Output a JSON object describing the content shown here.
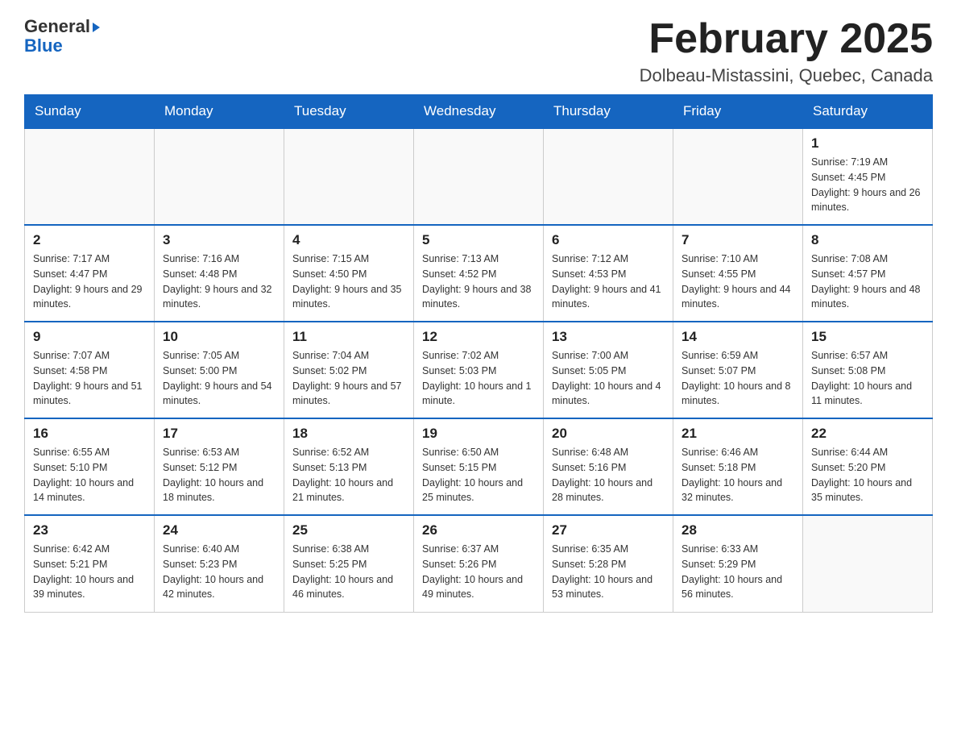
{
  "header": {
    "logo_general": "General",
    "logo_blue": "Blue",
    "month_title": "February 2025",
    "location": "Dolbeau-Mistassini, Quebec, Canada"
  },
  "days_of_week": [
    "Sunday",
    "Monday",
    "Tuesday",
    "Wednesday",
    "Thursday",
    "Friday",
    "Saturday"
  ],
  "weeks": [
    [
      {
        "day": "",
        "sunrise": "",
        "sunset": "",
        "daylight": ""
      },
      {
        "day": "",
        "sunrise": "",
        "sunset": "",
        "daylight": ""
      },
      {
        "day": "",
        "sunrise": "",
        "sunset": "",
        "daylight": ""
      },
      {
        "day": "",
        "sunrise": "",
        "sunset": "",
        "daylight": ""
      },
      {
        "day": "",
        "sunrise": "",
        "sunset": "",
        "daylight": ""
      },
      {
        "day": "",
        "sunrise": "",
        "sunset": "",
        "daylight": ""
      },
      {
        "day": "1",
        "sunrise": "Sunrise: 7:19 AM",
        "sunset": "Sunset: 4:45 PM",
        "daylight": "Daylight: 9 hours and 26 minutes."
      }
    ],
    [
      {
        "day": "2",
        "sunrise": "Sunrise: 7:17 AM",
        "sunset": "Sunset: 4:47 PM",
        "daylight": "Daylight: 9 hours and 29 minutes."
      },
      {
        "day": "3",
        "sunrise": "Sunrise: 7:16 AM",
        "sunset": "Sunset: 4:48 PM",
        "daylight": "Daylight: 9 hours and 32 minutes."
      },
      {
        "day": "4",
        "sunrise": "Sunrise: 7:15 AM",
        "sunset": "Sunset: 4:50 PM",
        "daylight": "Daylight: 9 hours and 35 minutes."
      },
      {
        "day": "5",
        "sunrise": "Sunrise: 7:13 AM",
        "sunset": "Sunset: 4:52 PM",
        "daylight": "Daylight: 9 hours and 38 minutes."
      },
      {
        "day": "6",
        "sunrise": "Sunrise: 7:12 AM",
        "sunset": "Sunset: 4:53 PM",
        "daylight": "Daylight: 9 hours and 41 minutes."
      },
      {
        "day": "7",
        "sunrise": "Sunrise: 7:10 AM",
        "sunset": "Sunset: 4:55 PM",
        "daylight": "Daylight: 9 hours and 44 minutes."
      },
      {
        "day": "8",
        "sunrise": "Sunrise: 7:08 AM",
        "sunset": "Sunset: 4:57 PM",
        "daylight": "Daylight: 9 hours and 48 minutes."
      }
    ],
    [
      {
        "day": "9",
        "sunrise": "Sunrise: 7:07 AM",
        "sunset": "Sunset: 4:58 PM",
        "daylight": "Daylight: 9 hours and 51 minutes."
      },
      {
        "day": "10",
        "sunrise": "Sunrise: 7:05 AM",
        "sunset": "Sunset: 5:00 PM",
        "daylight": "Daylight: 9 hours and 54 minutes."
      },
      {
        "day": "11",
        "sunrise": "Sunrise: 7:04 AM",
        "sunset": "Sunset: 5:02 PM",
        "daylight": "Daylight: 9 hours and 57 minutes."
      },
      {
        "day": "12",
        "sunrise": "Sunrise: 7:02 AM",
        "sunset": "Sunset: 5:03 PM",
        "daylight": "Daylight: 10 hours and 1 minute."
      },
      {
        "day": "13",
        "sunrise": "Sunrise: 7:00 AM",
        "sunset": "Sunset: 5:05 PM",
        "daylight": "Daylight: 10 hours and 4 minutes."
      },
      {
        "day": "14",
        "sunrise": "Sunrise: 6:59 AM",
        "sunset": "Sunset: 5:07 PM",
        "daylight": "Daylight: 10 hours and 8 minutes."
      },
      {
        "day": "15",
        "sunrise": "Sunrise: 6:57 AM",
        "sunset": "Sunset: 5:08 PM",
        "daylight": "Daylight: 10 hours and 11 minutes."
      }
    ],
    [
      {
        "day": "16",
        "sunrise": "Sunrise: 6:55 AM",
        "sunset": "Sunset: 5:10 PM",
        "daylight": "Daylight: 10 hours and 14 minutes."
      },
      {
        "day": "17",
        "sunrise": "Sunrise: 6:53 AM",
        "sunset": "Sunset: 5:12 PM",
        "daylight": "Daylight: 10 hours and 18 minutes."
      },
      {
        "day": "18",
        "sunrise": "Sunrise: 6:52 AM",
        "sunset": "Sunset: 5:13 PM",
        "daylight": "Daylight: 10 hours and 21 minutes."
      },
      {
        "day": "19",
        "sunrise": "Sunrise: 6:50 AM",
        "sunset": "Sunset: 5:15 PM",
        "daylight": "Daylight: 10 hours and 25 minutes."
      },
      {
        "day": "20",
        "sunrise": "Sunrise: 6:48 AM",
        "sunset": "Sunset: 5:16 PM",
        "daylight": "Daylight: 10 hours and 28 minutes."
      },
      {
        "day": "21",
        "sunrise": "Sunrise: 6:46 AM",
        "sunset": "Sunset: 5:18 PM",
        "daylight": "Daylight: 10 hours and 32 minutes."
      },
      {
        "day": "22",
        "sunrise": "Sunrise: 6:44 AM",
        "sunset": "Sunset: 5:20 PM",
        "daylight": "Daylight: 10 hours and 35 minutes."
      }
    ],
    [
      {
        "day": "23",
        "sunrise": "Sunrise: 6:42 AM",
        "sunset": "Sunset: 5:21 PM",
        "daylight": "Daylight: 10 hours and 39 minutes."
      },
      {
        "day": "24",
        "sunrise": "Sunrise: 6:40 AM",
        "sunset": "Sunset: 5:23 PM",
        "daylight": "Daylight: 10 hours and 42 minutes."
      },
      {
        "day": "25",
        "sunrise": "Sunrise: 6:38 AM",
        "sunset": "Sunset: 5:25 PM",
        "daylight": "Daylight: 10 hours and 46 minutes."
      },
      {
        "day": "26",
        "sunrise": "Sunrise: 6:37 AM",
        "sunset": "Sunset: 5:26 PM",
        "daylight": "Daylight: 10 hours and 49 minutes."
      },
      {
        "day": "27",
        "sunrise": "Sunrise: 6:35 AM",
        "sunset": "Sunset: 5:28 PM",
        "daylight": "Daylight: 10 hours and 53 minutes."
      },
      {
        "day": "28",
        "sunrise": "Sunrise: 6:33 AM",
        "sunset": "Sunset: 5:29 PM",
        "daylight": "Daylight: 10 hours and 56 minutes."
      },
      {
        "day": "",
        "sunrise": "",
        "sunset": "",
        "daylight": ""
      }
    ]
  ]
}
